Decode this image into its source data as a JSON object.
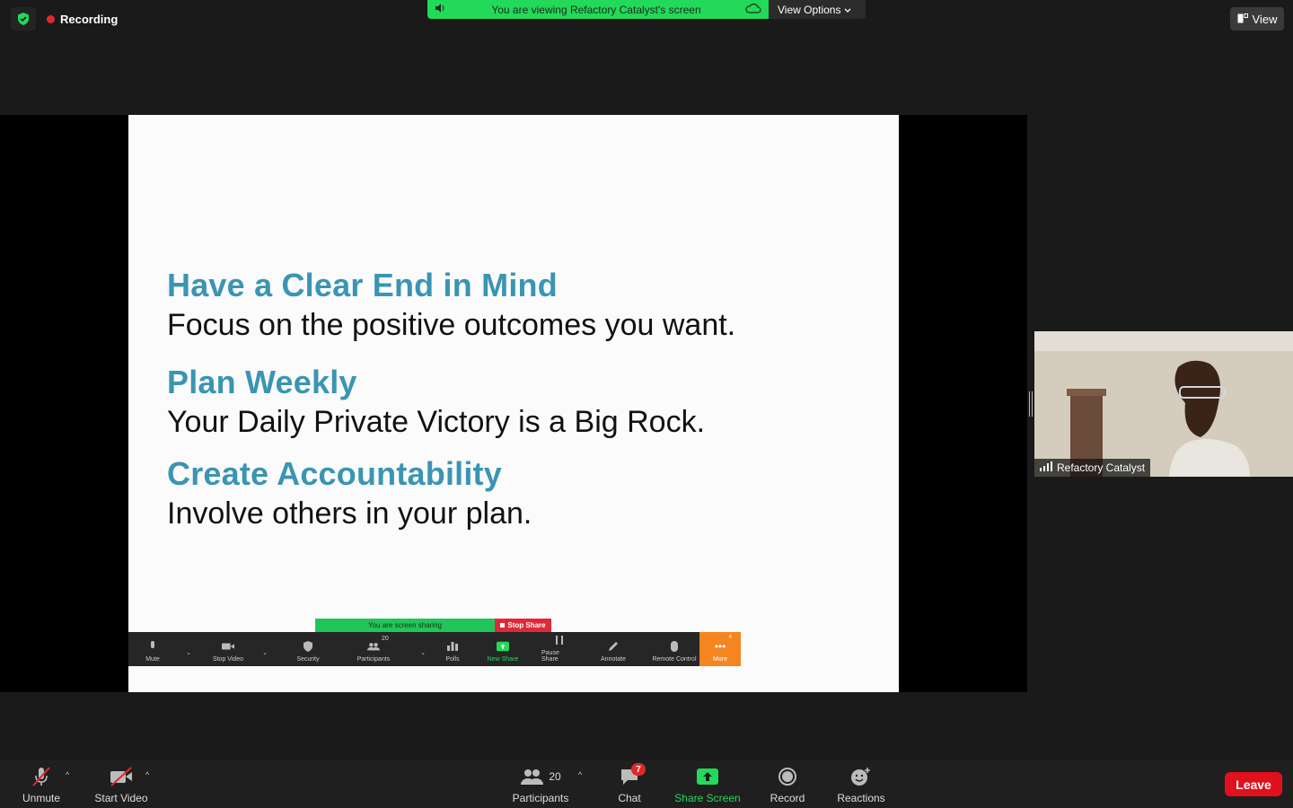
{
  "status": {
    "recording_label": "Recording",
    "accent_green": "#23d959",
    "record_red": "#e02828"
  },
  "banner": {
    "text": "You are viewing Refactory Catalyst's screen",
    "view_options_label": "View Options"
  },
  "view_button": {
    "label": "View"
  },
  "slide": {
    "points": [
      {
        "heading": "Have a Clear End in Mind",
        "body": "Focus on the positive outcomes you want."
      },
      {
        "heading": "Plan Weekly",
        "body": "Your Daily Private Victory is a Big Rock."
      },
      {
        "heading": "Create Accountability",
        "body": "Involve others in your plan."
      }
    ],
    "heading_color": "#3a95b3"
  },
  "mini_toolbar": {
    "sharing_text": "You are screen sharing",
    "stop_share_label": "Stop Share",
    "participants_count": "20",
    "more_badge": "4",
    "items": [
      {
        "label": "Mute"
      },
      {
        "label": "Stop Video"
      },
      {
        "label": "Security"
      },
      {
        "label": "Participants"
      },
      {
        "label": "Polls"
      },
      {
        "label": "New Share"
      },
      {
        "label": "Pause Share"
      },
      {
        "label": "Annotate"
      },
      {
        "label": "Remote Control"
      },
      {
        "label": "More"
      }
    ]
  },
  "participant": {
    "name": "Refactory Catalyst"
  },
  "toolbar": {
    "unmute_label": "Unmute",
    "start_video_label": "Start Video",
    "participants_label": "Participants",
    "participants_count": "20",
    "chat_label": "Chat",
    "chat_badge": "7",
    "share_screen_label": "Share Screen",
    "record_label": "Record",
    "reactions_label": "Reactions",
    "leave_label": "Leave"
  }
}
